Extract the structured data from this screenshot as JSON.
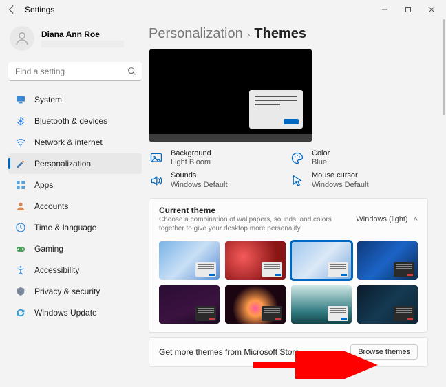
{
  "window": {
    "title": "Settings"
  },
  "user": {
    "name": "Diana Ann Roe"
  },
  "search": {
    "placeholder": "Find a setting"
  },
  "sidebar": {
    "items": [
      {
        "label": "System",
        "icon": "system"
      },
      {
        "label": "Bluetooth & devices",
        "icon": "bluetooth"
      },
      {
        "label": "Network & internet",
        "icon": "network"
      },
      {
        "label": "Personalization",
        "icon": "personalization",
        "active": true
      },
      {
        "label": "Apps",
        "icon": "apps"
      },
      {
        "label": "Accounts",
        "icon": "accounts"
      },
      {
        "label": "Time & language",
        "icon": "time"
      },
      {
        "label": "Gaming",
        "icon": "gaming"
      },
      {
        "label": "Accessibility",
        "icon": "accessibility"
      },
      {
        "label": "Privacy & security",
        "icon": "privacy"
      },
      {
        "label": "Windows Update",
        "icon": "update"
      }
    ]
  },
  "breadcrumb": {
    "parent": "Personalization",
    "current": "Themes"
  },
  "quick": {
    "background": {
      "title": "Background",
      "value": "Light Bloom"
    },
    "color": {
      "title": "Color",
      "value": "Blue"
    },
    "sounds": {
      "title": "Sounds",
      "value": "Windows Default"
    },
    "cursor": {
      "title": "Mouse cursor",
      "value": "Windows Default"
    }
  },
  "current_theme": {
    "title": "Current theme",
    "subtitle": "Choose a combination of wallpapers, sounds, and colors together to give your desktop more personality",
    "value": "Windows (light)"
  },
  "themes": [
    {
      "id": 1,
      "style": "bloom-blue-light",
      "bg": "linear-gradient(135deg,#7ab3e6 0%,#c9dff5 50%,#5a8fd6 100%)"
    },
    {
      "id": 2,
      "style": "glow-red",
      "bg": "radial-gradient(circle at 30% 40%,#f55a5a 0%,#8a1515 70%)"
    },
    {
      "id": 3,
      "style": "bloom-blue-light-sel",
      "bg": "linear-gradient(135deg,#9dc6ee 0%,#dce9f7 50%,#7aa9dc 100%)",
      "selected": true
    },
    {
      "id": 4,
      "style": "bloom-blue-dark",
      "bg": "linear-gradient(135deg,#0e3a7a 0%,#1c63c6 50%,#0b2a55 100%)",
      "dark": true
    },
    {
      "id": 5,
      "style": "gradient-violet",
      "bg": "linear-gradient(160deg,#2a0e33 0%,#3b1240 60%,#1a0b22 100%)",
      "dark": true
    },
    {
      "id": 6,
      "style": "flower-dark",
      "bg": "radial-gradient(circle at 50% 60%,#ff5aa0 0%,#ff9a4a 20%,#1a0510 60%)",
      "dark": true
    },
    {
      "id": 7,
      "style": "landscape-teal",
      "bg": "linear-gradient(180deg,#cfe7e4 0%,#2f7a80 70%,#14444a 100%)"
    },
    {
      "id": 8,
      "style": "wave-dark",
      "bg": "linear-gradient(135deg,#0a1a2a 0%,#143a52 50%,#0d2436 100%)",
      "dark": true
    }
  ],
  "store": {
    "prompt": "Get more themes from Microsoft Store",
    "button": "Browse themes"
  }
}
